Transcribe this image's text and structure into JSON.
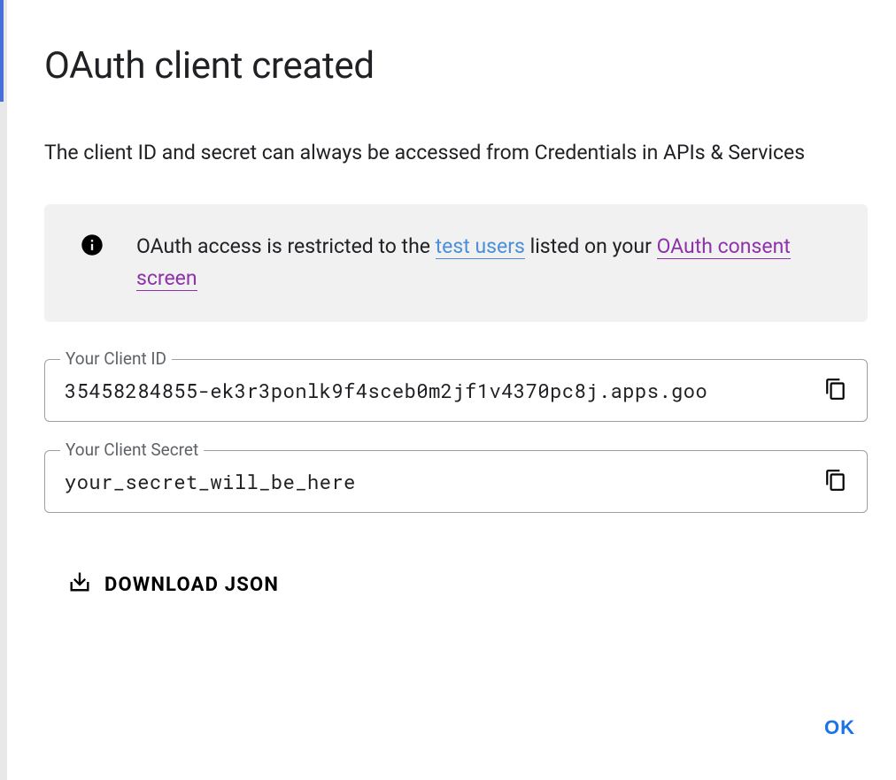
{
  "dialog": {
    "title": "OAuth client created",
    "description": "The client ID and secret can always be accessed from Credentials in APIs & Services",
    "info_banner": {
      "prefix": "OAuth access is restricted to the ",
      "link_test_users": "test users",
      "middle": " listed on your ",
      "link_consent": "OAuth consent screen"
    },
    "fields": {
      "client_id": {
        "label": "Your Client ID",
        "value": "35458284855-ek3r3ponlk9f4sceb0m2jf1v4370pc8j.apps.goo"
      },
      "client_secret": {
        "label": "Your Client Secret",
        "value": "your_secret_will_be_here"
      }
    },
    "download_label": "DOWNLOAD JSON",
    "ok_label": "OK"
  }
}
